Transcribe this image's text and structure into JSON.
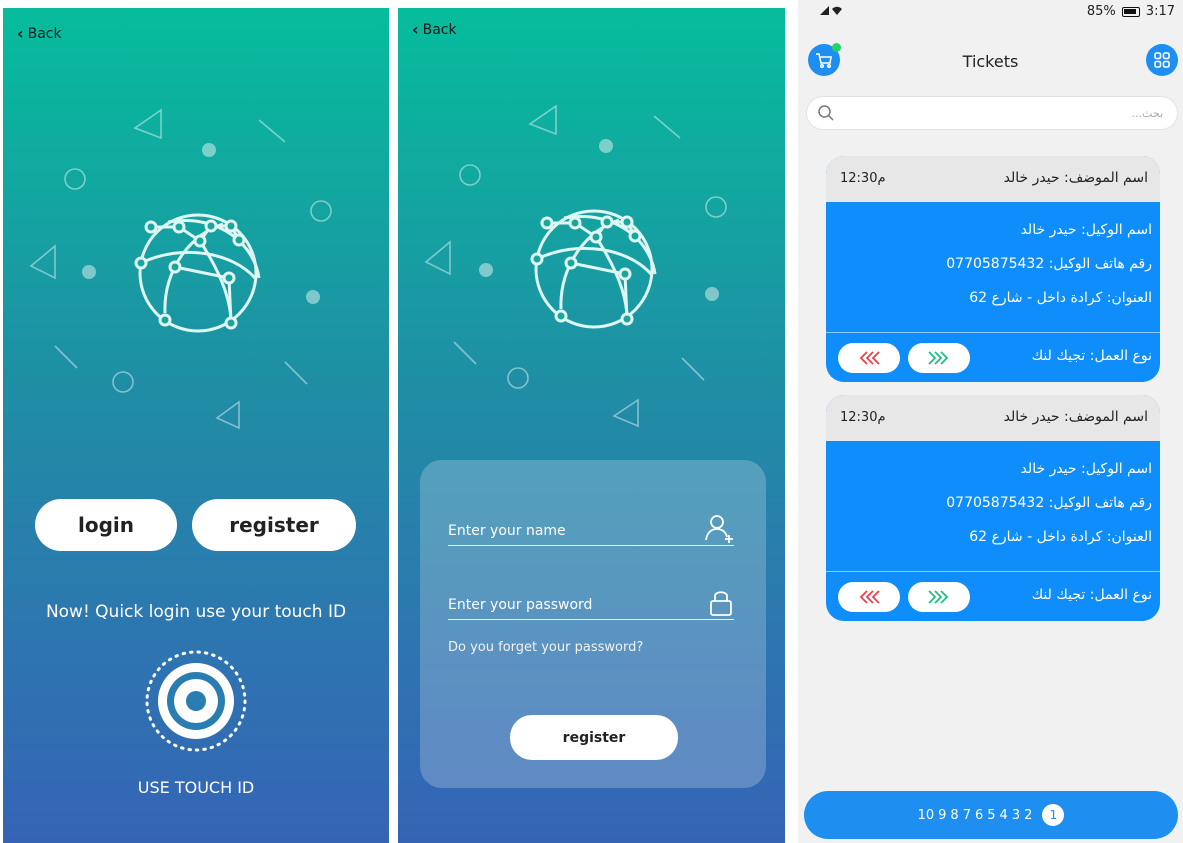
{
  "screen1": {
    "back_label": "Back",
    "login_label": "login",
    "register_label": "register",
    "touch_message": "Now! Quick login use your touch ID",
    "touch_label": "USE TOUCH ID"
  },
  "screen2": {
    "back_label": "Back",
    "name_placeholder": "Enter your name",
    "password_placeholder": "Enter your password",
    "forgot_label": "Do you forget your password?",
    "register_label": "register"
  },
  "screen3": {
    "status": {
      "battery": "85%",
      "time": "3:17"
    },
    "title": "Tickets",
    "search_placeholder": "بحث...",
    "tickets": [
      {
        "employee": "اسم الموضف: حيدر خالد",
        "time": "12:30م",
        "agent": "اسم الوكيل: حيدر خالد",
        "phone": "رقم هاتف الوكيل: 07705875432",
        "address": "العنوان: كرادة داخل - شارع 62",
        "work_type": "نوع العمل: تجيك لنك"
      },
      {
        "employee": "اسم الموضف: حيدر خالد",
        "time": "12:30م",
        "agent": "اسم الوكيل: حيدر خالد",
        "phone": "رقم هاتف الوكيل: 07705875432",
        "address": "العنوان: كرادة داخل - شارع 62",
        "work_type": "نوع العمل: تجيك لنك"
      }
    ],
    "pagination": {
      "pages": [
        "10",
        "9",
        "8",
        "7",
        "6",
        "5",
        "4",
        "3",
        "2"
      ],
      "current": "1"
    }
  },
  "colors": {
    "gradient_top": "#06bd9c",
    "gradient_bottom": "#3564b5",
    "card_blue": "#0f8dfb",
    "accent_blue": "#1e8ff0",
    "reject_red": "#e8414b",
    "accept_green": "#19c27f"
  }
}
